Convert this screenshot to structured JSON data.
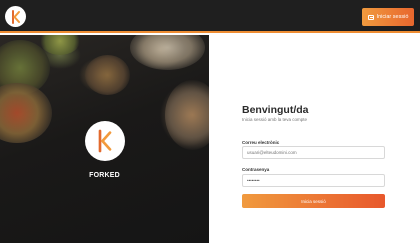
{
  "header": {
    "logo_icon": "forked-k-logo-icon",
    "login_button_icon": "login-door-icon",
    "login_button_label": "Iniciar sessió",
    "accent": "#ee8d33"
  },
  "hero": {
    "logo_icon": "forked-k-logo-icon",
    "brand_name": "FORKED"
  },
  "form": {
    "title": "Benvingut/da",
    "subtitle": "Inicia sessió amb la teva compte",
    "email_label": "Correu electrònic",
    "email_placeholder": "usuari@elteudomini.com",
    "password_label": "Contrasenya",
    "password_value": "••••••••",
    "submit_label": "Inicia sessió",
    "accent": "#e8672e"
  }
}
